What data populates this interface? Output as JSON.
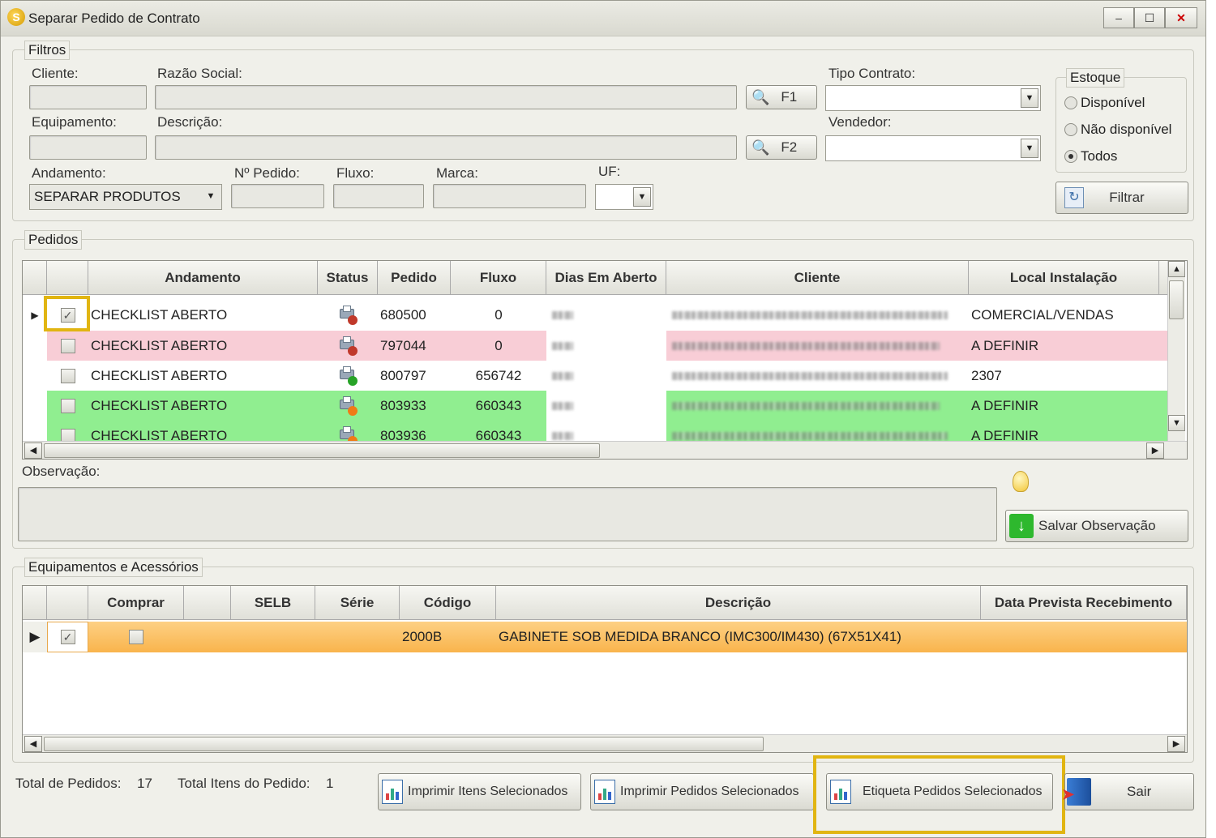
{
  "window": {
    "title": "Separar Pedido de Contrato",
    "min": "–",
    "max": "☐",
    "close": "✕"
  },
  "filters": {
    "legend": "Filtros",
    "cliente_label": "Cliente:",
    "razao_label": "Razão Social:",
    "f1": "F1",
    "tipo_contrato_label": "Tipo Contrato:",
    "equipamento_label": "Equipamento:",
    "descricao_label": "Descrição:",
    "f2": "F2",
    "vendedor_label": "Vendedor:",
    "andamento_label": "Andamento:",
    "andamento_value": "SEPARAR PRODUTOS",
    "pedido_label": "Nº Pedido:",
    "fluxo_label": "Fluxo:",
    "marca_label": "Marca:",
    "uf_label": "UF:",
    "estoque": {
      "legend": "Estoque",
      "options": [
        "Disponível",
        "Não disponível",
        "Todos"
      ],
      "selected": "Todos"
    },
    "filtrar": "Filtrar"
  },
  "pedidos": {
    "legend": "Pedidos",
    "columns": [
      "Andamento",
      "Status",
      "Pedido",
      "Fluxo",
      "Dias Em Aberto",
      "Cliente",
      "Local Instalação"
    ],
    "rows": [
      {
        "checked": true,
        "andamento": "CHECKLIST ABERTO",
        "pedido": "680500",
        "fluxo": "0",
        "local": "COMERCIAL/VENDAS",
        "bg": "#ffffff",
        "status_color": "#c0392b"
      },
      {
        "checked": false,
        "andamento": "CHECKLIST ABERTO",
        "pedido": "797044",
        "fluxo": "0",
        "local": "A DEFINIR",
        "bg": "#f8cdd6",
        "status_color": "#c0392b"
      },
      {
        "checked": false,
        "andamento": "CHECKLIST ABERTO",
        "pedido": "800797",
        "fluxo": "656742",
        "local": "2307",
        "bg": "#ffffff",
        "status_color": "#27a327"
      },
      {
        "checked": false,
        "andamento": "CHECKLIST ABERTO",
        "pedido": "803933",
        "fluxo": "660343",
        "local": "A DEFINIR",
        "bg": "#90ee90",
        "status_color": "#f07b16"
      },
      {
        "checked": false,
        "andamento": "CHECKLIST ABERTO",
        "pedido": "803936",
        "fluxo": "660343",
        "local": "A DEFINIR",
        "bg": "#90ee90",
        "status_color": "#f07b16"
      }
    ]
  },
  "observacao": {
    "label": "Observação:",
    "salvar": "Salvar Observação"
  },
  "equipamentos": {
    "legend": "Equipamentos e Acessórios",
    "columns": [
      "Comprar",
      "",
      "SELB",
      "Série",
      "Código",
      "Descrição",
      "Data Prevista Recebimento"
    ],
    "rows": [
      {
        "codigo": "2000B",
        "descricao": "GABINETE SOB MEDIDA BRANCO (IMC300/IM430) (67X51X41)"
      }
    ]
  },
  "footer": {
    "total_pedidos_label": "Total de Pedidos:",
    "total_pedidos": "17",
    "total_itens_label": "Total Itens do Pedido:",
    "total_itens": "1",
    "imprimir_itens": "Imprimir Itens Selecionados",
    "imprimir_pedidos": "Imprimir Pedidos Selecionados",
    "etiqueta": "Etiqueta Pedidos Selecionados",
    "sair": "Sair"
  },
  "colors": {
    "highlight": "#e1b512",
    "selected_row": "#fdc06a"
  }
}
